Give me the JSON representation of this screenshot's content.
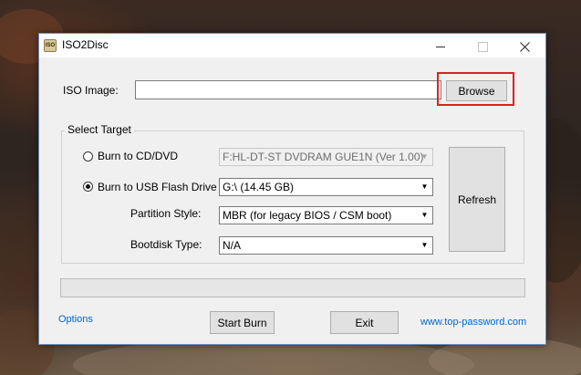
{
  "window": {
    "title": "ISO2Disc",
    "icon_text": "ISO"
  },
  "iso_image": {
    "label": "ISO Image:",
    "value": "",
    "browse_label": "Browse"
  },
  "select_target": {
    "title": "Select Target",
    "burn_cd": {
      "label": "Burn to CD/DVD",
      "selected": false,
      "drive": "F:HL-DT-ST DVDRAM GUE1N (Ver 1.00)"
    },
    "burn_usb": {
      "label": "Burn to USB Flash Drive",
      "selected": true,
      "drive": "G:\\ (14.45 GB)"
    },
    "partition_style": {
      "label": "Partition Style:",
      "value": "MBR (for legacy BIOS / CSM boot)"
    },
    "bootdisk_type": {
      "label": "Bootdisk Type:",
      "value": "N/A"
    },
    "refresh_label": "Refresh"
  },
  "progress": {
    "fraction": 0
  },
  "footer": {
    "options_label": "Options",
    "start_burn_label": "Start Burn",
    "exit_label": "Exit",
    "website_label": "www.top-password.com"
  },
  "colors": {
    "highlight": "#e02020",
    "link": "#0066cc"
  }
}
